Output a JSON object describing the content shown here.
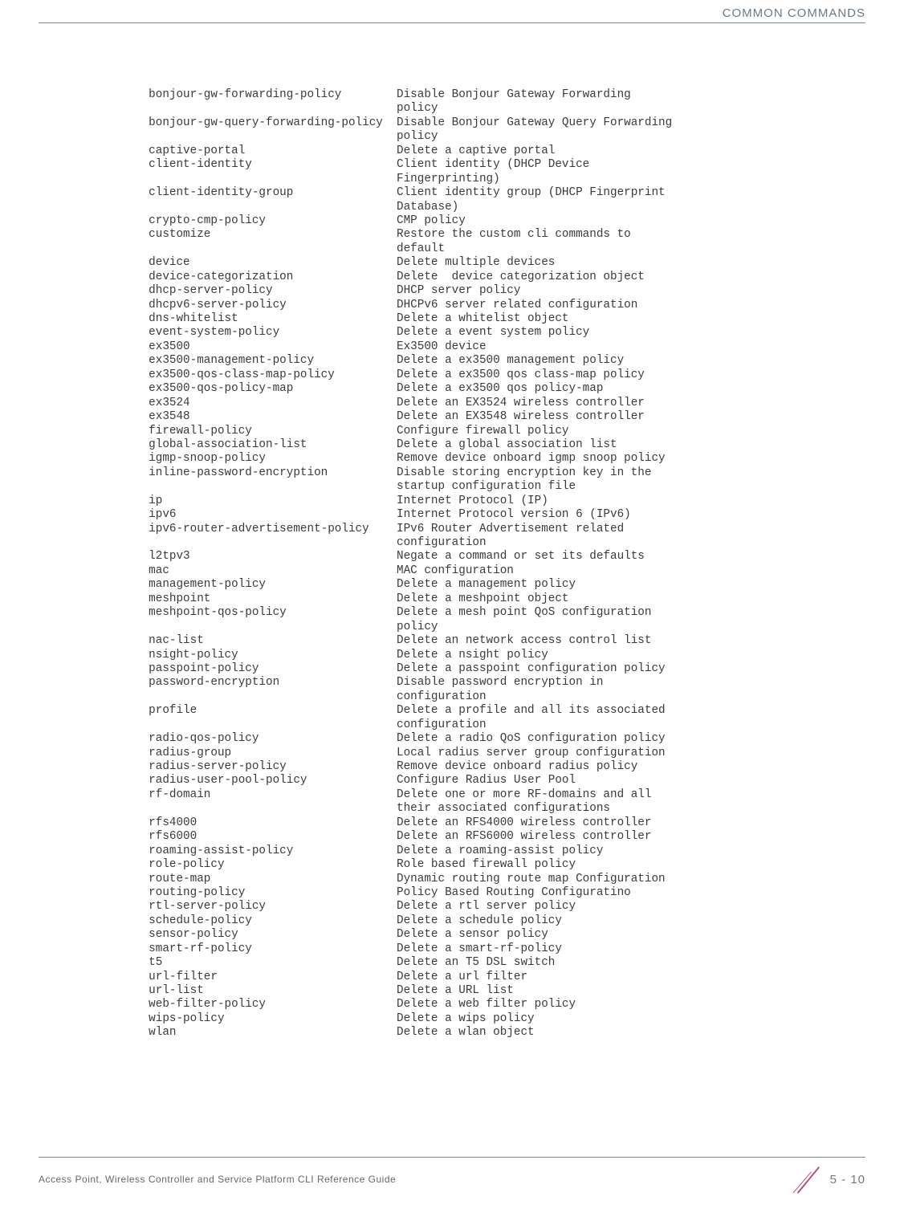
{
  "header": {
    "title": "COMMON COMMANDS"
  },
  "commands": [
    {
      "cmd": "bonjour-gw-forwarding-policy",
      "desc": "Disable Bonjour Gateway Forwarding\npolicy"
    },
    {
      "cmd": "bonjour-gw-query-forwarding-policy",
      "desc": "Disable Bonjour Gateway Query Forwarding\npolicy"
    },
    {
      "cmd": "captive-portal",
      "desc": "Delete a captive portal"
    },
    {
      "cmd": "client-identity",
      "desc": "Client identity (DHCP Device\nFingerprinting)"
    },
    {
      "cmd": "client-identity-group",
      "desc": "Client identity group (DHCP Fingerprint\nDatabase)"
    },
    {
      "cmd": "crypto-cmp-policy",
      "desc": "CMP policy"
    },
    {
      "cmd": "customize",
      "desc": "Restore the custom cli commands to\ndefault"
    },
    {
      "cmd": "device",
      "desc": "Delete multiple devices"
    },
    {
      "cmd": "device-categorization",
      "desc": "Delete  device categorization object"
    },
    {
      "cmd": "dhcp-server-policy",
      "desc": "DHCP server policy"
    },
    {
      "cmd": "dhcpv6-server-policy",
      "desc": "DHCPv6 server related configuration"
    },
    {
      "cmd": "dns-whitelist",
      "desc": "Delete a whitelist object"
    },
    {
      "cmd": "event-system-policy",
      "desc": "Delete a event system policy"
    },
    {
      "cmd": "ex3500",
      "desc": "Ex3500 device"
    },
    {
      "cmd": "ex3500-management-policy",
      "desc": "Delete a ex3500 management policy"
    },
    {
      "cmd": "ex3500-qos-class-map-policy",
      "desc": "Delete a ex3500 qos class-map policy"
    },
    {
      "cmd": "ex3500-qos-policy-map",
      "desc": "Delete a ex3500 qos policy-map"
    },
    {
      "cmd": "ex3524",
      "desc": "Delete an EX3524 wireless controller"
    },
    {
      "cmd": "ex3548",
      "desc": "Delete an EX3548 wireless controller"
    },
    {
      "cmd": "firewall-policy",
      "desc": "Configure firewall policy"
    },
    {
      "cmd": "global-association-list",
      "desc": "Delete a global association list"
    },
    {
      "cmd": "igmp-snoop-policy",
      "desc": "Remove device onboard igmp snoop policy"
    },
    {
      "cmd": "inline-password-encryption",
      "desc": "Disable storing encryption key in the\nstartup configuration file"
    },
    {
      "cmd": "ip",
      "desc": "Internet Protocol (IP)"
    },
    {
      "cmd": "ipv6",
      "desc": "Internet Protocol version 6 (IPv6)"
    },
    {
      "cmd": "ipv6-router-advertisement-policy",
      "desc": "IPv6 Router Advertisement related\nconfiguration"
    },
    {
      "cmd": "l2tpv3",
      "desc": "Negate a command or set its defaults"
    },
    {
      "cmd": "mac",
      "desc": "MAC configuration"
    },
    {
      "cmd": "management-policy",
      "desc": "Delete a management policy"
    },
    {
      "cmd": "meshpoint",
      "desc": "Delete a meshpoint object"
    },
    {
      "cmd": "meshpoint-qos-policy",
      "desc": "Delete a mesh point QoS configuration\npolicy"
    },
    {
      "cmd": "nac-list",
      "desc": "Delete an network access control list"
    },
    {
      "cmd": "nsight-policy",
      "desc": "Delete a nsight policy"
    },
    {
      "cmd": "passpoint-policy",
      "desc": "Delete a passpoint configuration policy"
    },
    {
      "cmd": "password-encryption",
      "desc": "Disable password encryption in\nconfiguration"
    },
    {
      "cmd": "profile",
      "desc": "Delete a profile and all its associated\nconfiguration"
    },
    {
      "cmd": "radio-qos-policy",
      "desc": "Delete a radio QoS configuration policy"
    },
    {
      "cmd": "radius-group",
      "desc": "Local radius server group configuration"
    },
    {
      "cmd": "radius-server-policy",
      "desc": "Remove device onboard radius policy"
    },
    {
      "cmd": "radius-user-pool-policy",
      "desc": "Configure Radius User Pool"
    },
    {
      "cmd": "rf-domain",
      "desc": "Delete one or more RF-domains and all\ntheir associated configurations"
    },
    {
      "cmd": "rfs4000",
      "desc": "Delete an RFS4000 wireless controller"
    },
    {
      "cmd": "rfs6000",
      "desc": "Delete an RFS6000 wireless controller"
    },
    {
      "cmd": "roaming-assist-policy",
      "desc": "Delete a roaming-assist policy"
    },
    {
      "cmd": "role-policy",
      "desc": "Role based firewall policy"
    },
    {
      "cmd": "route-map",
      "desc": "Dynamic routing route map Configuration"
    },
    {
      "cmd": "routing-policy",
      "desc": "Policy Based Routing Configuratino"
    },
    {
      "cmd": "rtl-server-policy",
      "desc": "Delete a rtl server policy"
    },
    {
      "cmd": "schedule-policy",
      "desc": "Delete a schedule policy"
    },
    {
      "cmd": "sensor-policy",
      "desc": "Delete a sensor policy"
    },
    {
      "cmd": "smart-rf-policy",
      "desc": "Delete a smart-rf-policy"
    },
    {
      "cmd": "t5",
      "desc": "Delete an T5 DSL switch"
    },
    {
      "cmd": "url-filter",
      "desc": "Delete a url filter"
    },
    {
      "cmd": "url-list",
      "desc": "Delete a URL list"
    },
    {
      "cmd": "web-filter-policy",
      "desc": "Delete a web filter policy"
    },
    {
      "cmd": "wips-policy",
      "desc": "Delete a wips policy"
    },
    {
      "cmd": "wlan",
      "desc": "Delete a wlan object"
    }
  ],
  "footer": {
    "left": "Access Point, Wireless Controller and Service Platform CLI Reference Guide",
    "page": "5 - 10"
  }
}
